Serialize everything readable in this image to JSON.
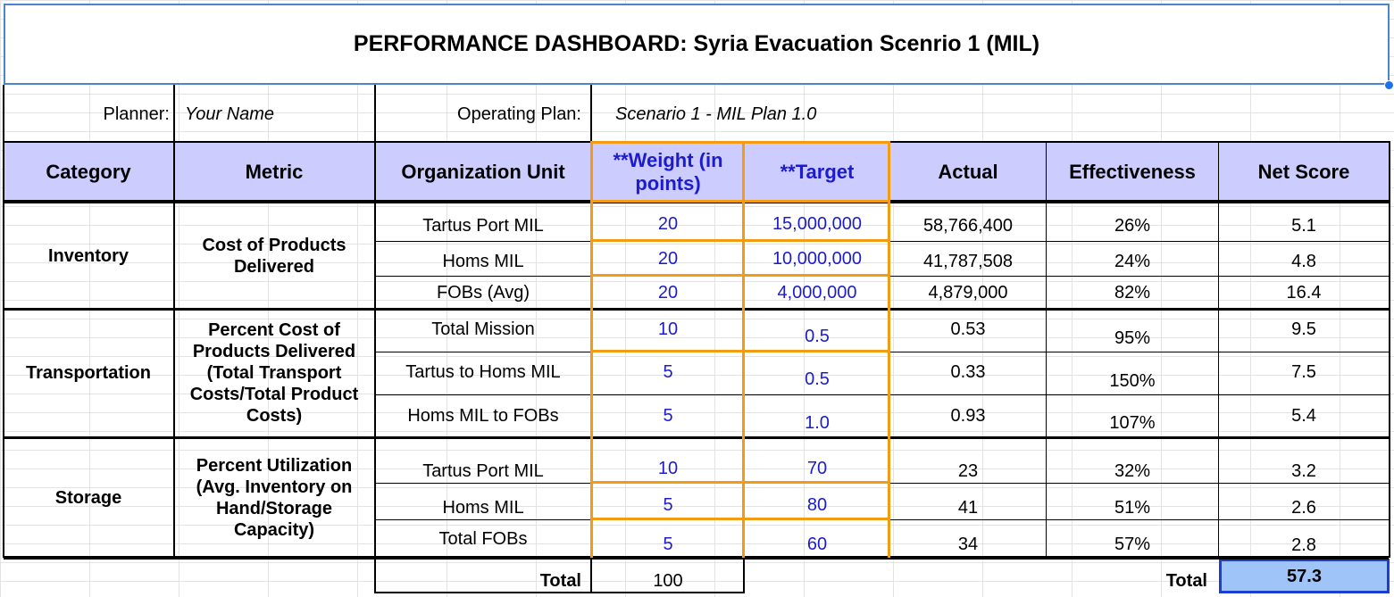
{
  "title": "PERFORMANCE DASHBOARD: Syria Evacuation Scenrio 1 (MIL)",
  "planner": {
    "label": "Planner:",
    "value": "Your Name"
  },
  "operating_plan": {
    "label": "Operating Plan:",
    "value": "Scenario 1 - MIL Plan 1.0"
  },
  "headers": {
    "category": "Category",
    "metric": "Metric",
    "org_unit": "Organization Unit",
    "weight": "**Weight (in points)",
    "target": "**Target",
    "actual": "Actual",
    "effectiveness": "Effectiveness",
    "net_score": "Net Score"
  },
  "groups": [
    {
      "category": "Inventory",
      "metric": "Cost of Products Delivered",
      "rows": [
        {
          "unit": "Tartus Port MIL",
          "weight": "20",
          "target": "15,000,000",
          "actual": "58,766,400",
          "effectiveness": "26%",
          "net": "5.1"
        },
        {
          "unit": "Homs MIL",
          "weight": "20",
          "target": "10,000,000",
          "actual": "41,787,508",
          "effectiveness": "24%",
          "net": "4.8"
        },
        {
          "unit": "FOBs (Avg)",
          "weight": "20",
          "target": "4,000,000",
          "actual": "4,879,000",
          "effectiveness": "82%",
          "net": "16.4"
        }
      ]
    },
    {
      "category": "Transportation",
      "metric": "Percent Cost of Products Delivered (Total Transport Costs/Total Product Costs)",
      "rows": [
        {
          "unit": "Total Mission",
          "weight": "10",
          "target": "0.5",
          "actual": "0.53",
          "effectiveness": "95%",
          "net": "9.5"
        },
        {
          "unit": "Tartus to Homs MIL",
          "weight": "5",
          "target": "0.5",
          "actual": "0.33",
          "effectiveness": "150%",
          "net": "7.5"
        },
        {
          "unit": "Homs MIL to FOBs",
          "weight": "5",
          "target": "1.0",
          "actual": "0.93",
          "effectiveness": "107%",
          "net": "5.4"
        }
      ]
    },
    {
      "category": "Storage",
      "metric": "Percent Utilization (Avg. Inventory on Hand/Storage Capacity)",
      "rows": [
        {
          "unit": "Tartus Port MIL",
          "weight": "10",
          "target": "70",
          "actual": "23",
          "effectiveness": "32%",
          "net": "3.2"
        },
        {
          "unit": "Homs MIL",
          "weight": "5",
          "target": "80",
          "actual": "41",
          "effectiveness": "51%",
          "net": "2.6"
        },
        {
          "unit": "Total FOBs",
          "weight": "5",
          "target": "60",
          "actual": "34",
          "effectiveness": "57%",
          "net": "2.8"
        }
      ]
    }
  ],
  "totals": {
    "weight_label": "Total",
    "weight_value": "100",
    "score_label": "Total",
    "score_value": "57.3"
  },
  "colors": {
    "header_bg": "#ccccff",
    "highlight_border": "#f39c12",
    "blue_text": "#1c1ccc",
    "total_score_bg": "#9fc5f8",
    "total_score_border": "#1c3fd1"
  }
}
